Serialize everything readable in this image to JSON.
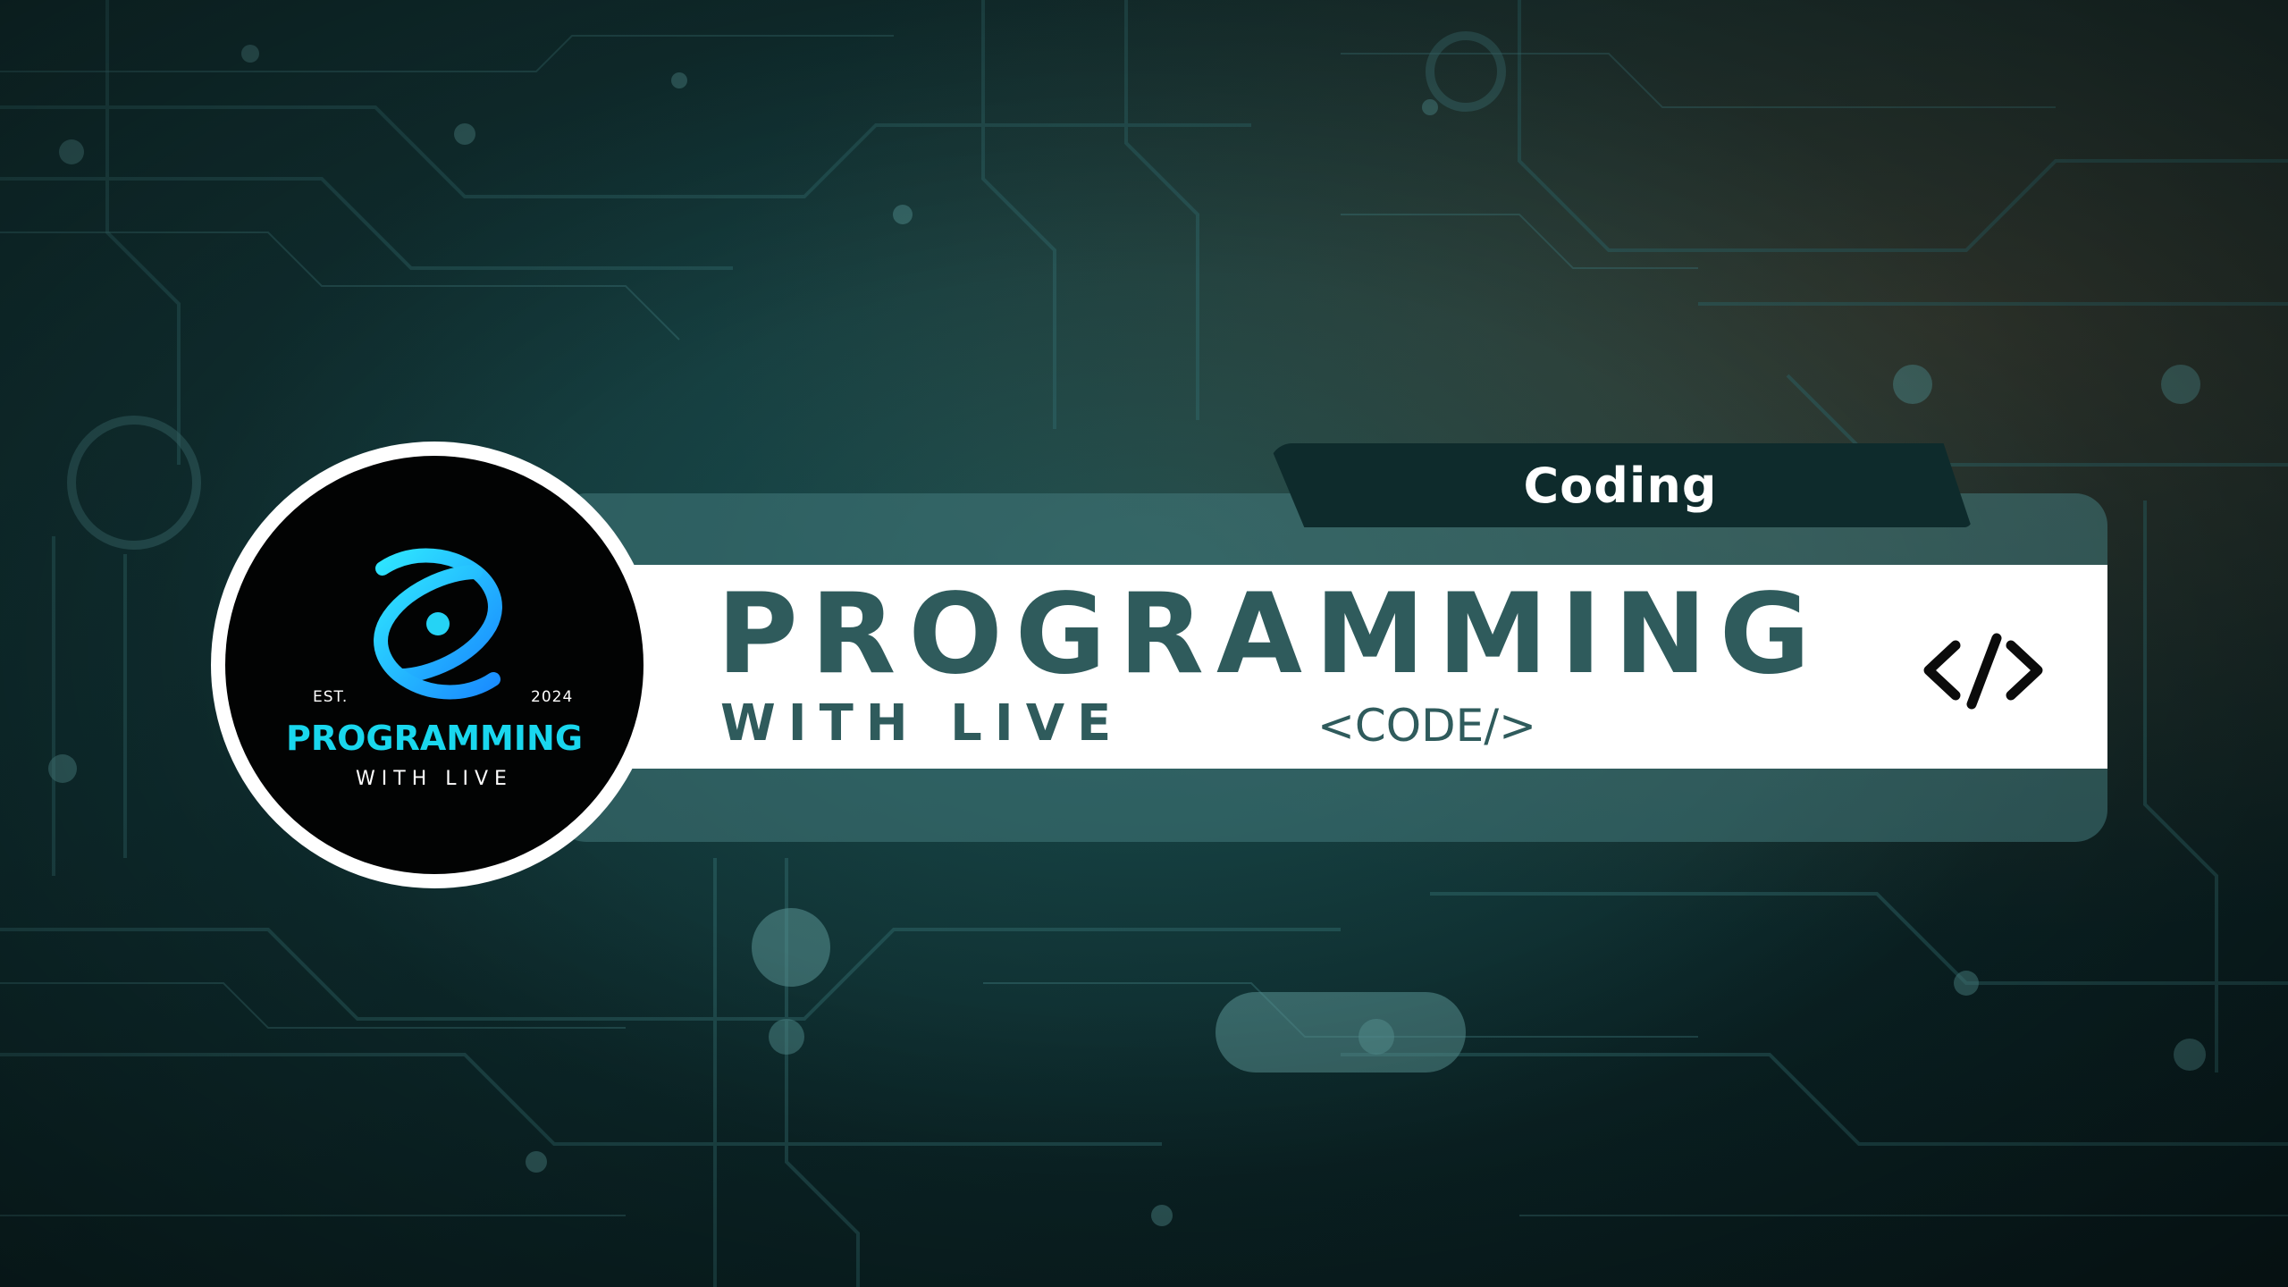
{
  "logo": {
    "est": "EST.",
    "year": "2024",
    "title": "PROGRAMMING",
    "subtitle": "WITH LIVE",
    "icon": "atom-orbit-icon"
  },
  "tag": {
    "label": "Coding"
  },
  "banner": {
    "title": "PROGRAMMING",
    "subtitle": "WITH LIVE",
    "code_label": "<CODE/>",
    "icon": "code-brackets-icon"
  },
  "colors": {
    "background": "#0f2f31",
    "band": "#447a7c",
    "tag": "#0e2b2c",
    "title": "#2f5b5c",
    "logo_accent": "#19d7ee"
  }
}
